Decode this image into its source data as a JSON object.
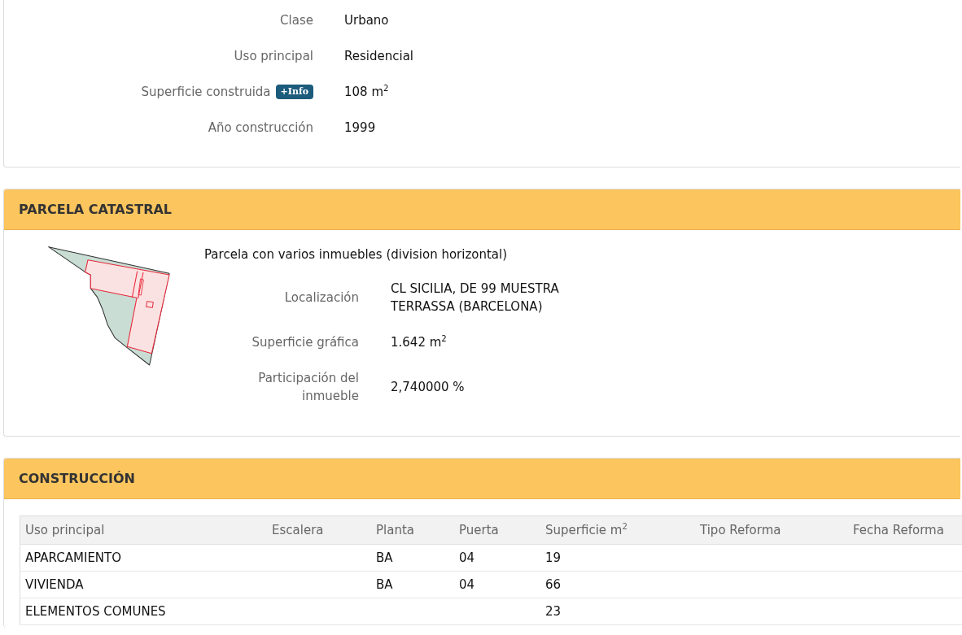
{
  "summary": {
    "rows": [
      {
        "label": "Clase",
        "value": "Urbano"
      },
      {
        "label": "Uso principal",
        "value": "Residencial"
      },
      {
        "label": "Superficie construida",
        "badge": "+Info",
        "value": "108 m$^{2}$"
      },
      {
        "label": "Año construcción",
        "value": "1999"
      }
    ]
  },
  "parcela_catastral": {
    "title": "PARCELA CATASTRAL",
    "description": "Parcela con varios inmuebles (division horizontal)",
    "rows": [
      {
        "label": "Localización",
        "value_lines": [
          "CL SICILIA, DE 99 MUESTRA",
          "TERRASSA (BARCELONA)"
        ]
      },
      {
        "label": "Superficie gráfica",
        "value_lines": [
          "1.642 m$^{2}$"
        ]
      },
      {
        "label": "Participación del inmueble",
        "value_lines": [
          "2,740000 %"
        ]
      }
    ]
  },
  "construccion": {
    "title": "CONSTRUCCIÓN",
    "table": {
      "columns": [
        "Uso principal",
        "Escalera",
        "Planta",
        "Puerta",
        "Superficie m$^{2}$",
        "Tipo Reforma",
        "Fecha Reforma"
      ],
      "rows": [
        [
          "APARCAMIENTO",
          null,
          "BA",
          "04",
          "19",
          null,
          null
        ],
        [
          "VIVIENDA",
          null,
          "BA",
          "04",
          "66",
          null,
          null
        ],
        [
          "ELEMENTOS COMUNES",
          null,
          null,
          null,
          "23",
          null,
          null
        ]
      ]
    }
  }
}
